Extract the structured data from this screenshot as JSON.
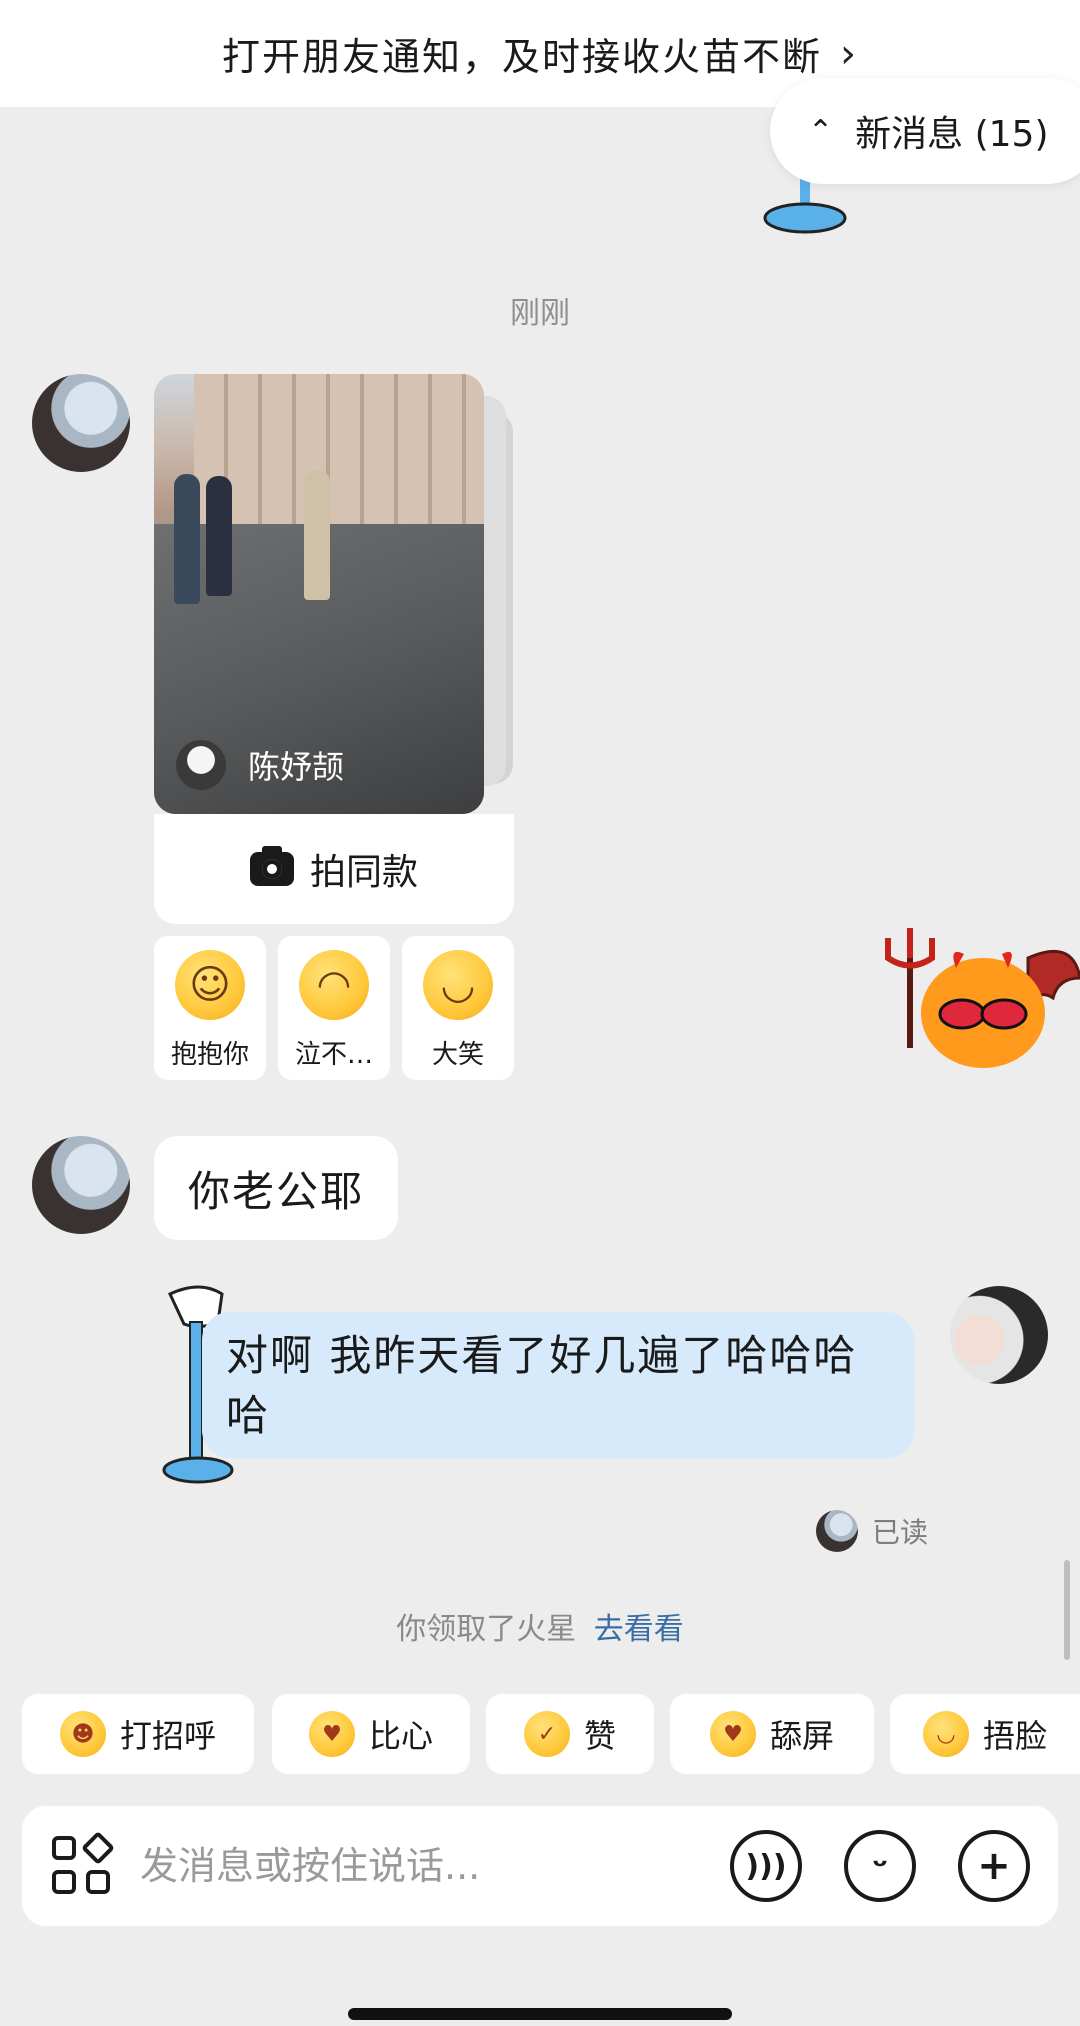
{
  "top_banner": {
    "text": "打开朋友通知，及时接收火苗不断",
    "chevron": "›"
  },
  "new_messages": {
    "label": "新消息 (15)",
    "icon": "double-chevron-up-icon"
  },
  "timestamp": "刚刚",
  "shared_video": {
    "author": "陈妤颉",
    "action_label": "拍同款"
  },
  "reactions": [
    {
      "label": "抱抱你",
      "icon": "hug-emoji-icon"
    },
    {
      "label": "泣不…",
      "icon": "crying-emoji-icon"
    },
    {
      "label": "大笑",
      "icon": "laughing-emoji-icon"
    }
  ],
  "messages": {
    "incoming_text": "你老公耶",
    "outgoing_text": "对啊 我昨天看了好几遍了哈哈哈哈",
    "read_status": "已读"
  },
  "spark_notice": {
    "text": "你领取了火星",
    "link": "去看看"
  },
  "quick_replies": [
    {
      "label": "打招呼",
      "icon": "wave-emoji-icon"
    },
    {
      "label": "比心",
      "icon": "heart-hands-emoji-icon"
    },
    {
      "label": "赞",
      "icon": "thumbs-up-emoji-icon"
    },
    {
      "label": "舔屏",
      "icon": "heart-eyes-emoji-icon"
    },
    {
      "label": "捂脸",
      "icon": "facepalm-emoji-icon"
    }
  ],
  "composer": {
    "placeholder": "发消息或按住说话..."
  },
  "colors": {
    "background": "#ededed",
    "outgoing_bubble": "#d7eafb",
    "link": "#3a6ea5"
  }
}
